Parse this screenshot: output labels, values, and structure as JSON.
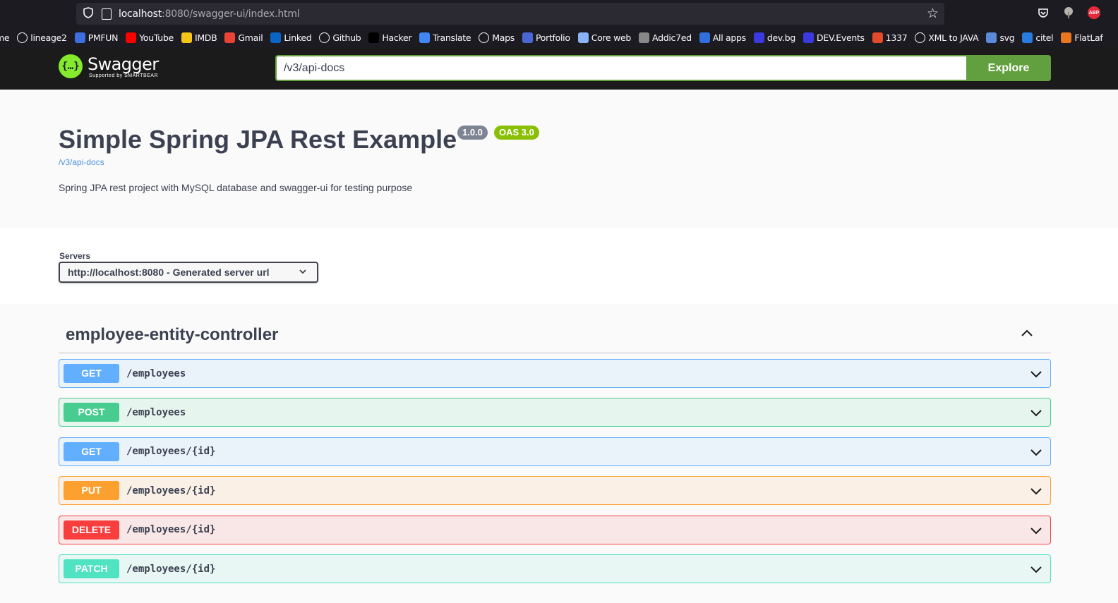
{
  "browser": {
    "url_host": "localhost",
    "url_path": ":8080/swagger-ui/index.html",
    "bookmarks": [
      {
        "label": "me",
        "icon": "none",
        "color": ""
      },
      {
        "label": "lineage2",
        "icon": "globe-icon",
        "color": "#fbfbfe"
      },
      {
        "label": "PMFUN",
        "icon": "pmfun-icon",
        "color": "#3d6fe0"
      },
      {
        "label": "YouTube",
        "icon": "youtube-icon",
        "color": "#ff0000"
      },
      {
        "label": "IMDB",
        "icon": "imdb-icon",
        "color": "#f5c518"
      },
      {
        "label": "Gmail",
        "icon": "gmail-icon",
        "color": "#ea4335"
      },
      {
        "label": "Linked",
        "icon": "linkedin-icon",
        "color": "#0a66c2"
      },
      {
        "label": "Github",
        "icon": "github-icon",
        "color": "#fbfbfe"
      },
      {
        "label": "Hacker",
        "icon": "hacker-icon",
        "color": "#000000"
      },
      {
        "label": "Translate",
        "icon": "translate-icon",
        "color": "#4285f4"
      },
      {
        "label": "Maps",
        "icon": "google-icon",
        "color": "#ffffff"
      },
      {
        "label": "Portfolio",
        "icon": "portfolio-icon",
        "color": "#4a67d6"
      },
      {
        "label": "Core web",
        "icon": "coreweb-icon",
        "color": "#8ab4f8"
      },
      {
        "label": "Addic7ed",
        "icon": "addic7ed-icon",
        "color": "#888888"
      },
      {
        "label": "All apps",
        "icon": "allapps-icon",
        "color": "#2f6fde"
      },
      {
        "label": "dev.bg",
        "icon": "devbg-icon",
        "color": "#3a3ae0"
      },
      {
        "label": "DEV.Events",
        "icon": "devevents-icon",
        "color": "#3a3ae0"
      },
      {
        "label": "1337",
        "icon": "1337-icon",
        "color": "#e24a2a"
      },
      {
        "label": "XML to JAVA",
        "icon": "xmljava-icon",
        "color": "#ffffff"
      },
      {
        "label": "svg",
        "icon": "svg-icon",
        "color": "#5b8ad8"
      },
      {
        "label": "citel",
        "icon": "citel-icon",
        "color": "#2a7be0"
      },
      {
        "label": "FlatLaf",
        "icon": "flatlaf-icon",
        "color": "#e8771f"
      }
    ]
  },
  "topbar": {
    "logo_name": "Swagger",
    "logo_sub": "Supported by SMARTBEAR",
    "spec_url": "/v3/api-docs",
    "explore_label": "Explore"
  },
  "info": {
    "title": "Simple Spring JPA Rest Example",
    "version": "1.0.0",
    "oas": "OAS 3.0",
    "spec_link": "/v3/api-docs",
    "description": "Spring JPA rest project with MySQL database and swagger-ui for testing purpose"
  },
  "servers": {
    "label": "Servers",
    "selected": "http://localhost:8080 - Generated server url"
  },
  "tag": {
    "name": "employee-entity-controller"
  },
  "operations": [
    {
      "method": "GET",
      "path": "/employees",
      "type": "get"
    },
    {
      "method": "POST",
      "path": "/employees",
      "type": "post"
    },
    {
      "method": "GET",
      "path": "/employees/{id}",
      "type": "get"
    },
    {
      "method": "PUT",
      "path": "/employees/{id}",
      "type": "put"
    },
    {
      "method": "DELETE",
      "path": "/employees/{id}",
      "type": "delete"
    },
    {
      "method": "PATCH",
      "path": "/employees/{id}",
      "type": "patch"
    }
  ],
  "colors": {
    "get": "#61affe",
    "post": "#49cc90",
    "put": "#fca130",
    "delete": "#f93e3e",
    "patch": "#50e3c2",
    "explore": "#62a03f"
  }
}
